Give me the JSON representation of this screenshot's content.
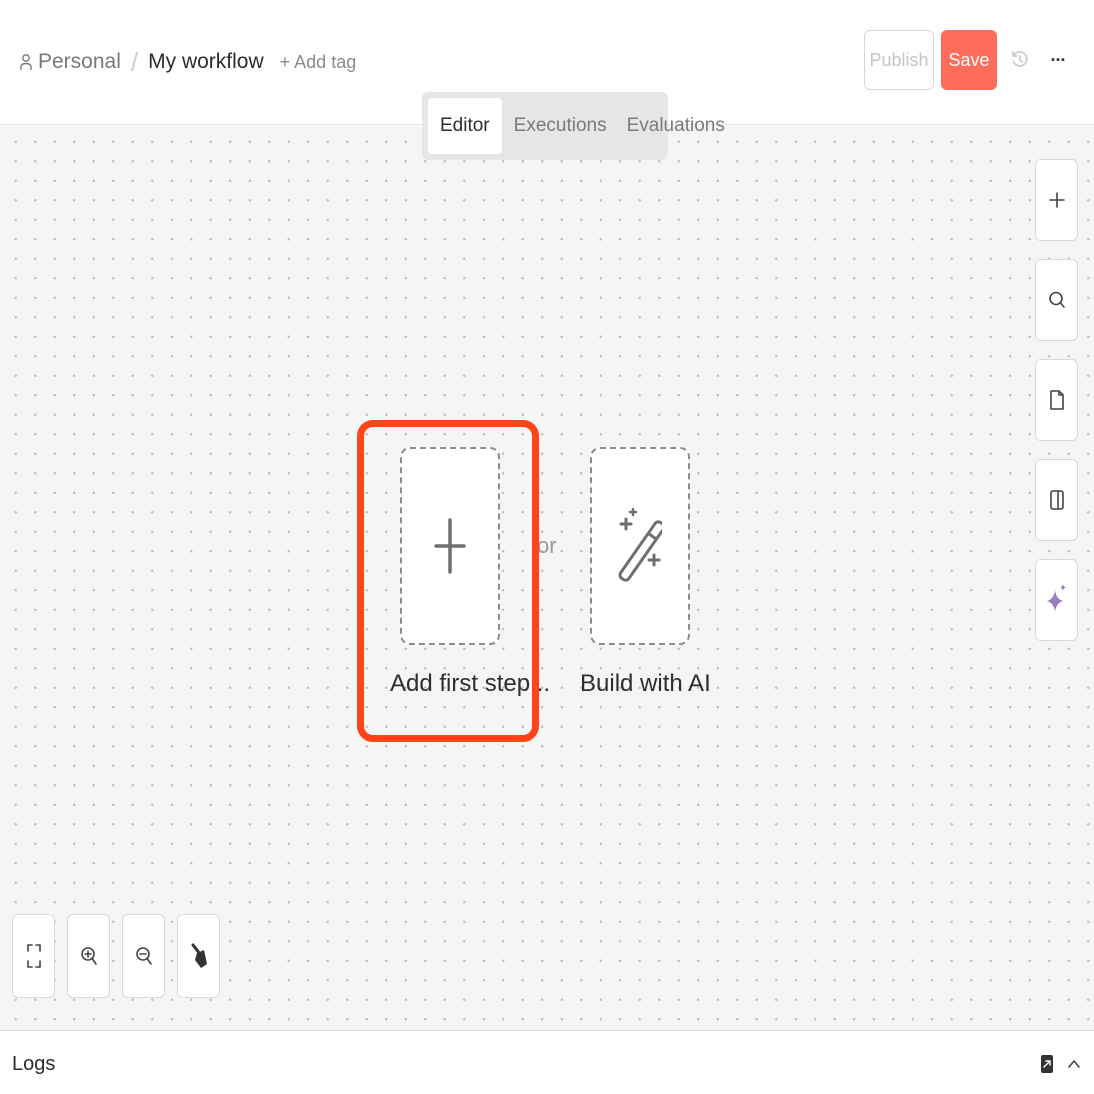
{
  "header": {
    "project": "Personal",
    "separator": "/",
    "workflow_name": "My workflow",
    "add_tag": "+ Add tag",
    "publish_label": "Publish",
    "save_label": "Save",
    "more_label": "···"
  },
  "tabs": [
    {
      "label": "Editor",
      "active": true
    },
    {
      "label": "Executions",
      "active": false
    },
    {
      "label": "Evaluations",
      "active": false
    }
  ],
  "canvas": {
    "or_label": "or",
    "nodes": [
      {
        "label": "Add first step...",
        "icon": "plus-icon",
        "highlighted": true
      },
      {
        "label": "Build with AI",
        "icon": "magic-wand-icon",
        "highlighted": false
      }
    ],
    "right_toolbar": [
      "plus-icon",
      "search-icon",
      "sticky-note-icon",
      "panel-toggle-icon",
      "ai-sparkle-icon"
    ],
    "bottom_controls": [
      "fit-view-icon",
      "zoom-in-icon",
      "zoom-out-icon",
      "tidy-up-icon"
    ]
  },
  "logs": {
    "title": "Logs"
  },
  "colors": {
    "accent": "#ff6d5a",
    "highlight": "#ff4419",
    "ai_sparkle": "#9b7bc4",
    "canvas_bg": "#f5f5f5"
  }
}
